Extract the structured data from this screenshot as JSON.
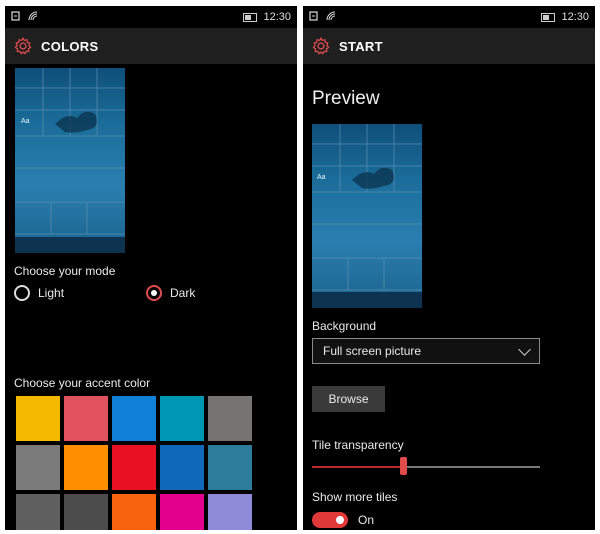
{
  "colors": {
    "accent": "#e04b4b",
    "header_bg": "#1f1f1f",
    "background": "#000000"
  },
  "left": {
    "status": {
      "time": "12:30"
    },
    "header": {
      "title": "COLORS",
      "icon": "gear-icon"
    },
    "preview": {
      "aa": "Aa"
    },
    "mode": {
      "label": "Choose your mode",
      "options": [
        {
          "label": "Light",
          "selected": false
        },
        {
          "label": "Dark",
          "selected": true
        }
      ]
    },
    "accent": {
      "label": "Choose your accent color",
      "swatches": [
        "#f5b800",
        "#e0525e",
        "#1180d8",
        "#0097b5",
        "#777371",
        "#7a7a7a",
        "#ff8f00",
        "#e81123",
        "#0f68b8",
        "#2d7d9a",
        "#5f5f5f",
        "#4c4c4c",
        "#f7630c",
        "#e3008c",
        "#8e8cd8"
      ]
    }
  },
  "right": {
    "status": {
      "time": "12:30"
    },
    "header": {
      "title": "START",
      "icon": "gear-icon"
    },
    "title": "Preview",
    "preview": {
      "aa": "Aa"
    },
    "background": {
      "label": "Background",
      "value": "Full screen picture"
    },
    "browse_label": "Browse",
    "transparency": {
      "label": "Tile transparency",
      "value": 0.4
    },
    "more_tiles": {
      "label": "Show more tiles",
      "state": "On"
    }
  }
}
